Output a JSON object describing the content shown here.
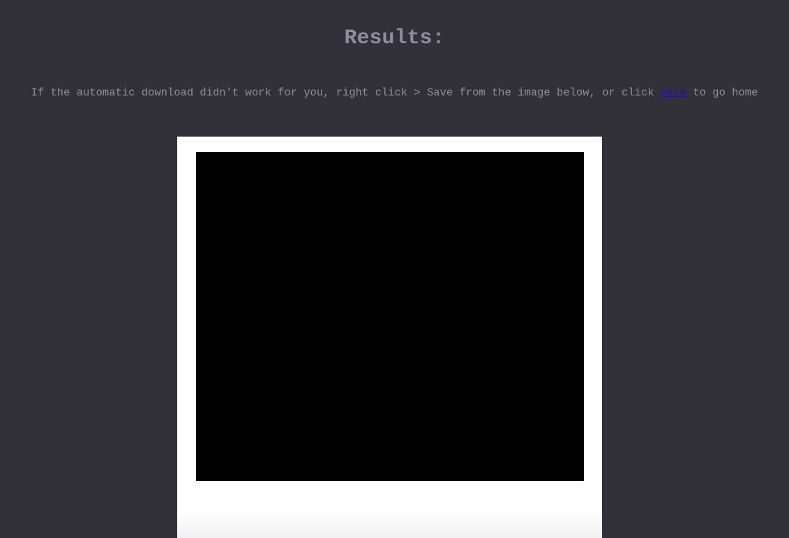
{
  "page": {
    "title": "Results:",
    "instructions": {
      "before_link": "If the automatic download didn't work for you, right click > Save from the image below, or click ",
      "link_text": "here",
      "after_link": " to go home"
    }
  },
  "colors": {
    "background": "#32313a",
    "text": "#8e8c9e",
    "link": "#1a12b4",
    "frame": "#ffffff",
    "photo": "#000000"
  }
}
